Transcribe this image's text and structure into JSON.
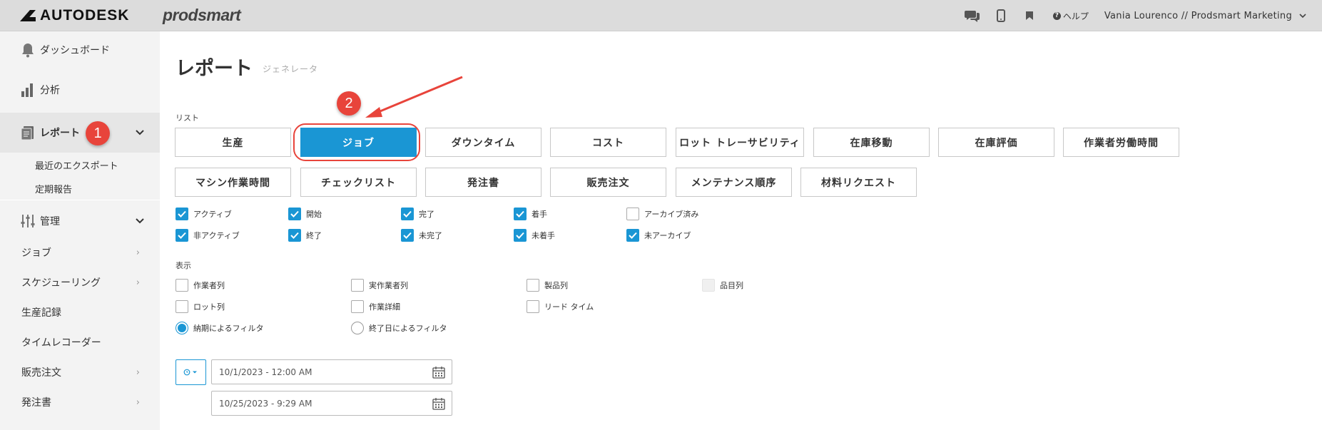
{
  "header": {
    "logo_text": "AUTODESK",
    "product": "prodsmart",
    "help_label": "ヘルプ",
    "user_label": "Vania Lourenco // Prodsmart Marketing"
  },
  "sidebar": {
    "dashboard": "ダッシュボード",
    "analytics": "分析",
    "reports": "レポート",
    "reports_sub": [
      "最近のエクスポート",
      "定期報告"
    ],
    "admin": "管理",
    "jobs": "ジョブ",
    "scheduling": "スケジューリング",
    "production_records": "生産記録",
    "time_recorder": "タイムレコーダー",
    "sales_orders": "販売注文",
    "purchase_orders": "発注書"
  },
  "main": {
    "title": "レポート",
    "subtitle": "ジェネレータ",
    "list_label": "リスト",
    "list_buttons_row1": [
      "生産",
      "ジョブ",
      "ダウンタイム",
      "コスト",
      "ロット トレーサビリティ",
      "在庫移動",
      "在庫評価",
      "作業者労働時間"
    ],
    "list_buttons_row2": [
      "マシン作業時間",
      "チェックリスト",
      "発注書",
      "販売注文",
      "メンテナンス順序",
      "材料リクエスト"
    ],
    "selected_button": "ジョブ",
    "filters_row1": [
      {
        "label": "アクティブ",
        "checked": true
      },
      {
        "label": "開始",
        "checked": true
      },
      {
        "label": "完了",
        "checked": true
      },
      {
        "label": "着手",
        "checked": true
      },
      {
        "label": "アーカイブ済み",
        "checked": false
      }
    ],
    "filters_row2": [
      {
        "label": "非アクティブ",
        "checked": true
      },
      {
        "label": "終了",
        "checked": true
      },
      {
        "label": "未完了",
        "checked": true
      },
      {
        "label": "未着手",
        "checked": true
      },
      {
        "label": "未アーカイブ",
        "checked": true
      }
    ],
    "display_label": "表示",
    "display_row1": [
      "作業者列",
      "実作業者列",
      "製品列",
      "品目列"
    ],
    "display_row2": [
      "ロット列",
      "作業詳細",
      "リード タイム"
    ],
    "radio_due": "納期によるフィルタ",
    "radio_end": "終了日によるフィルタ",
    "date_from": "10/1/2023 - 12:00 AM",
    "date_to": "10/25/2023 - 9:29 AM"
  },
  "annotations": {
    "step1": "1",
    "step2": "2",
    "color": "#e8443b"
  },
  "colors": {
    "accent": "#1a96d4",
    "topbar": "#dcdcdc",
    "sidebar": "#f3f3f3"
  }
}
